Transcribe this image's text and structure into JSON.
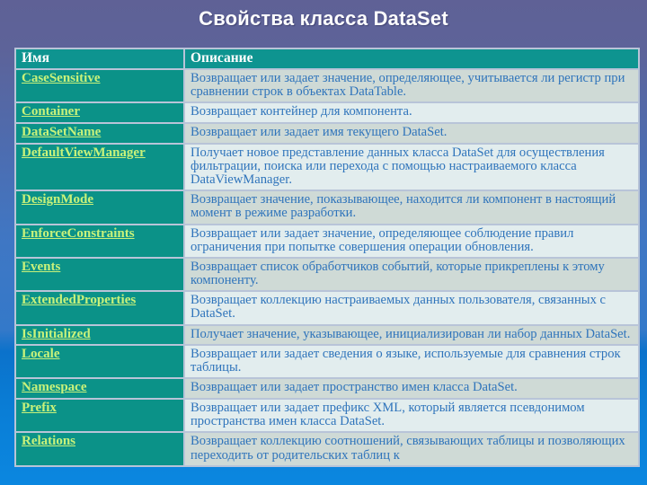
{
  "slide": {
    "title": "Свойства класса DataSet",
    "colors": {
      "title_text": "#ffffff",
      "header_bg": "#0e9490",
      "name_cell_bg": "#0b9288",
      "link_text": "#c9f27a",
      "desc_text": "#2f74bb",
      "desc_bg": "#cfdad6",
      "desc_bg_alt": "#e2edee",
      "background_top": "#5f6196",
      "background_bottom": "#0b87e0"
    }
  },
  "table": {
    "headers": {
      "name": "Имя",
      "description": "Описание"
    },
    "rows": [
      {
        "name": "CaseSensitive",
        "description": "Возвращает или задает значение, определяющее, учитывается ли регистр при сравнении строк в объектах DataTable."
      },
      {
        "name": "Container",
        "description": "Возвращает контейнер для компонента."
      },
      {
        "name": "DataSetName",
        "description": "Возвращает или задает имя текущего DataSet."
      },
      {
        "name": "DefaultViewManager",
        "description": "Получает новое представление данных класса DataSet для осуществления фильтрации, поиска или перехода с помощью настраиваемого класса DataViewManager."
      },
      {
        "name": "DesignMode",
        "description": "Возвращает значение, показывающее, находится ли компонент в настоящий момент в режиме разработки."
      },
      {
        "name": "EnforceConstraints",
        "description": "Возвращает или задает значение, определяющее соблюдение правил ограничения при попытке совершения операции обновления."
      },
      {
        "name": "Events",
        "description": "Возвращает список обработчиков событий, которые прикреплены к этому компоненту."
      },
      {
        "name": "ExtendedProperties",
        "description": "Возвращает коллекцию настраиваемых данных пользователя, связанных с DataSet."
      },
      {
        "name": "IsInitialized",
        "description": "Получает значение, указывающее, инициализирован ли набор данных DataSet."
      },
      {
        "name": "Locale",
        "description": "Возвращает или задает сведения о языке, используемые для сравнения строк таблицы."
      },
      {
        "name": "Namespace",
        "description": "Возвращает или задает пространство имен класса DataSet."
      },
      {
        "name": "Prefix",
        "description": "Возвращает или задает префикс XML, который является псевдонимом пространства имен класса DataSet."
      },
      {
        "name": "Relations",
        "description": "Возвращает коллекцию соотношений, связывающих таблицы и позволяющих переходить от родительских таблиц к"
      }
    ]
  }
}
